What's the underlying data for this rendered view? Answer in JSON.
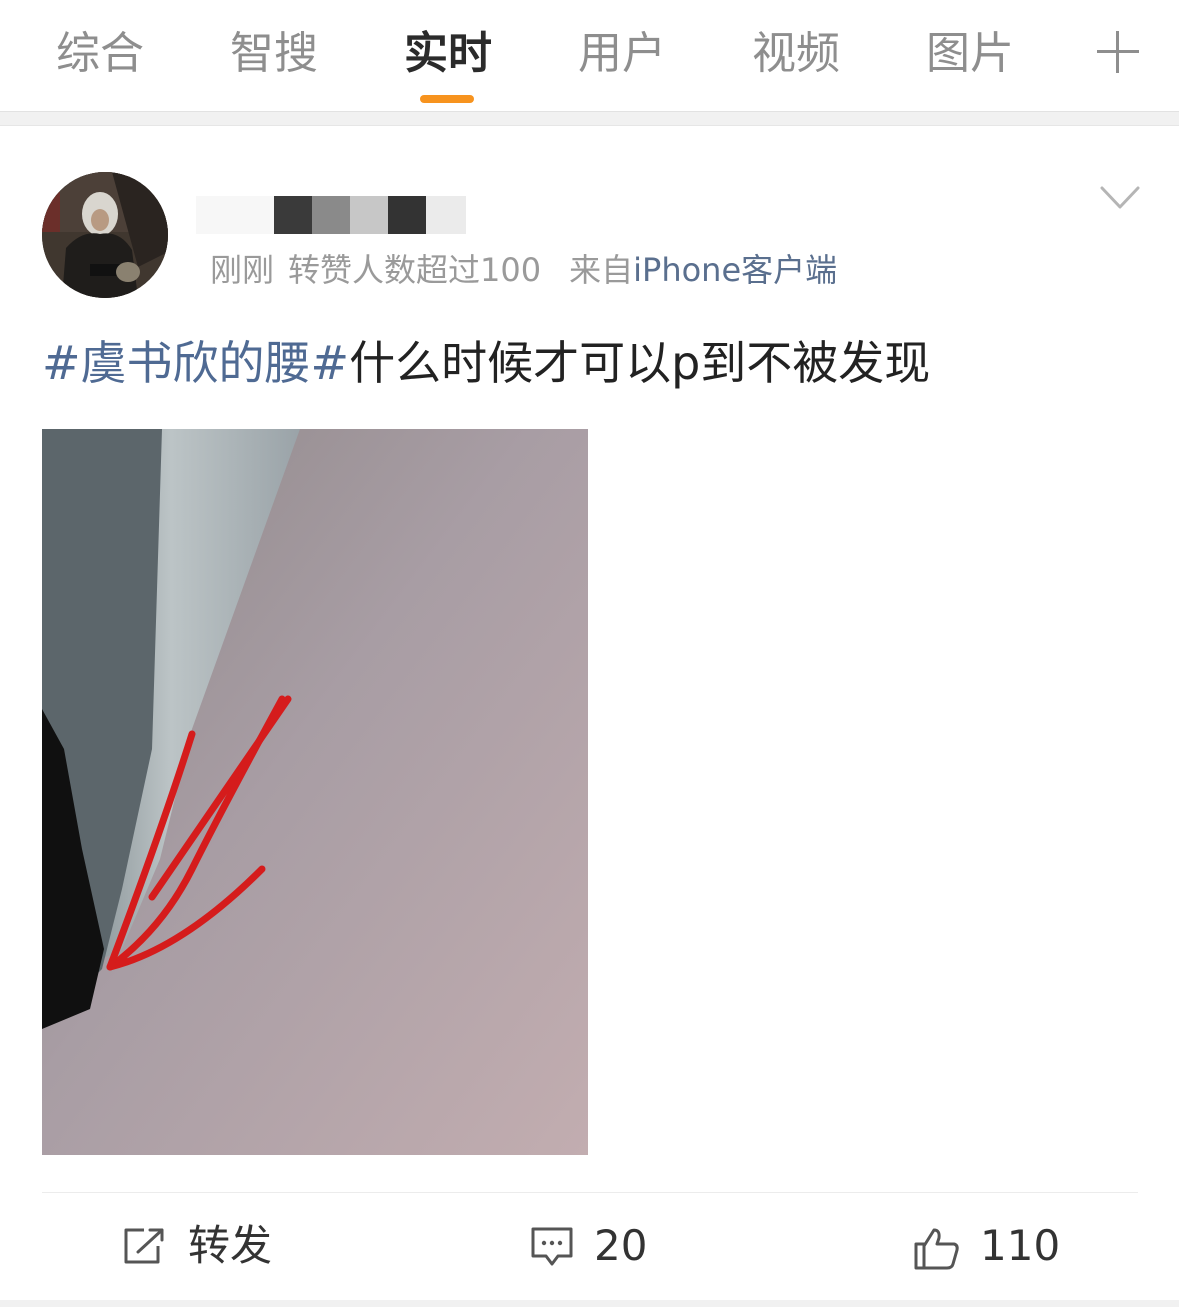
{
  "tabs": [
    {
      "label": "综合"
    },
    {
      "label": "智搜"
    },
    {
      "label": "实时",
      "active": true
    },
    {
      "label": "用户"
    },
    {
      "label": "视频"
    },
    {
      "label": "图片"
    }
  ],
  "tab_more_icon": "plus-icon",
  "accent_color": "#f7931e",
  "post": {
    "meta": {
      "time": "刚刚",
      "repost_note": "转赞人数超过100",
      "source_prefix": "来自",
      "source": "iPhone客户端"
    },
    "text": {
      "hashtag": "#虞书欣的腰#",
      "body": "什么时候才可以p到不被发现"
    },
    "actions": {
      "repost_label": "转发",
      "comment_count": "20",
      "like_count": "110"
    }
  }
}
